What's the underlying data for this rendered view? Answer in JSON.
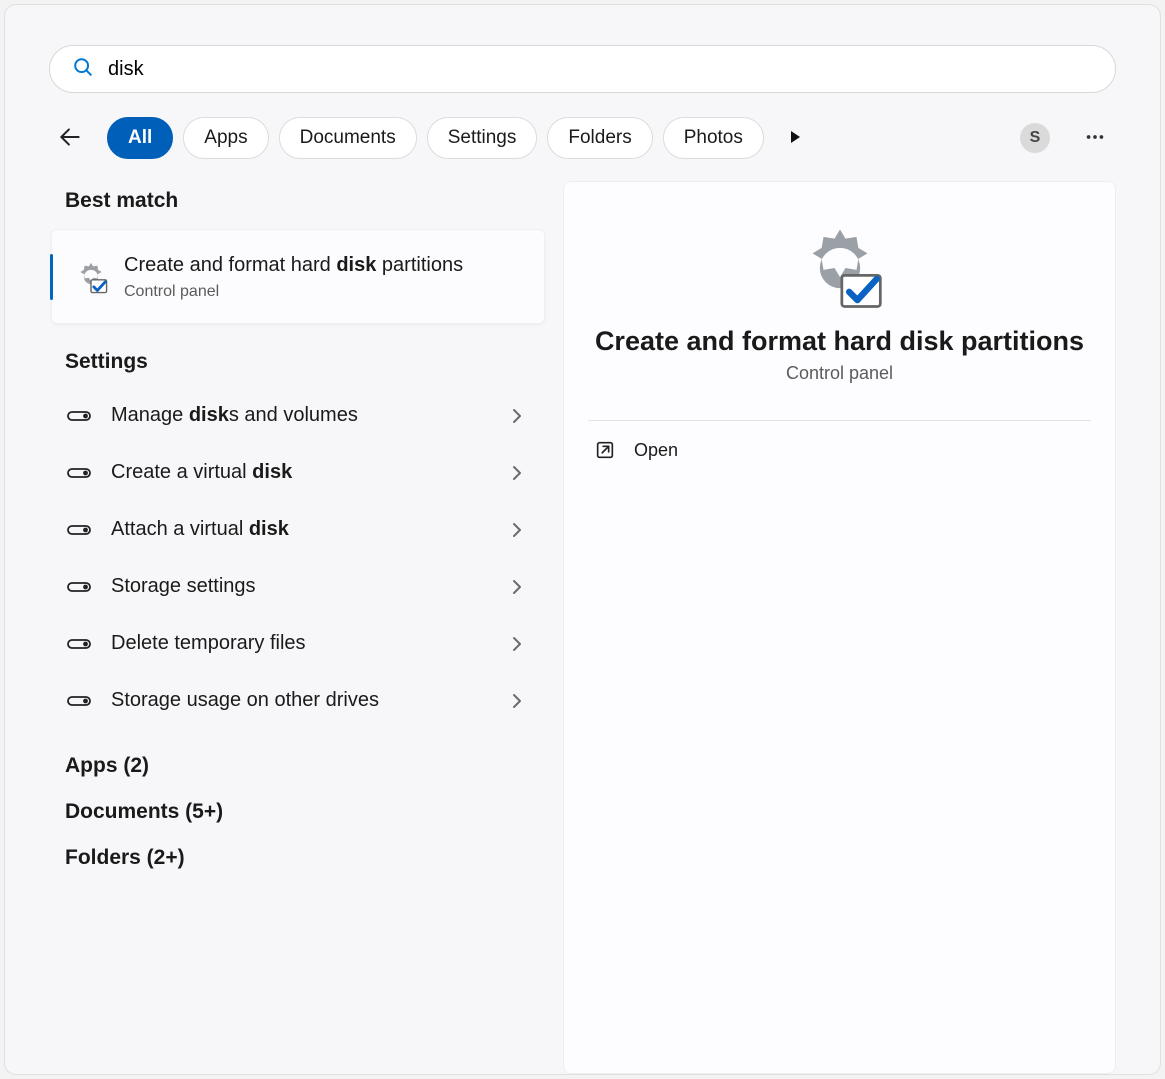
{
  "search": {
    "value": "disk",
    "placeholder": ""
  },
  "filters": {
    "items": [
      {
        "label": "All",
        "active": true
      },
      {
        "label": "Apps",
        "active": false
      },
      {
        "label": "Documents",
        "active": false
      },
      {
        "label": "Settings",
        "active": false
      },
      {
        "label": "Folders",
        "active": false
      },
      {
        "label": "Photos",
        "active": false
      }
    ]
  },
  "user_initial": "S",
  "results": {
    "best_match_header": "Best match",
    "best_match": {
      "title_pre": "Create and format hard ",
      "title_bold": "disk",
      "title_post": " partitions",
      "subtitle": "Control panel"
    },
    "settings_header": "Settings",
    "settings_items": [
      {
        "pre": "Manage ",
        "bold": "disk",
        "post": "s and volumes"
      },
      {
        "pre": "Create a virtual ",
        "bold": "disk",
        "post": ""
      },
      {
        "pre": "Attach a virtual ",
        "bold": "disk",
        "post": ""
      },
      {
        "pre": "Storage settings",
        "bold": "",
        "post": ""
      },
      {
        "pre": "Delete temporary files",
        "bold": "",
        "post": ""
      },
      {
        "pre": "Storage usage on other drives",
        "bold": "",
        "post": ""
      }
    ],
    "category_counts": [
      {
        "label": "Apps (2)"
      },
      {
        "label": "Documents (5+)"
      },
      {
        "label": "Folders (2+)"
      }
    ]
  },
  "preview": {
    "title": "Create and format hard disk partitions",
    "subtitle": "Control panel",
    "actions": [
      {
        "label": "Open",
        "icon": "open-external"
      }
    ]
  }
}
